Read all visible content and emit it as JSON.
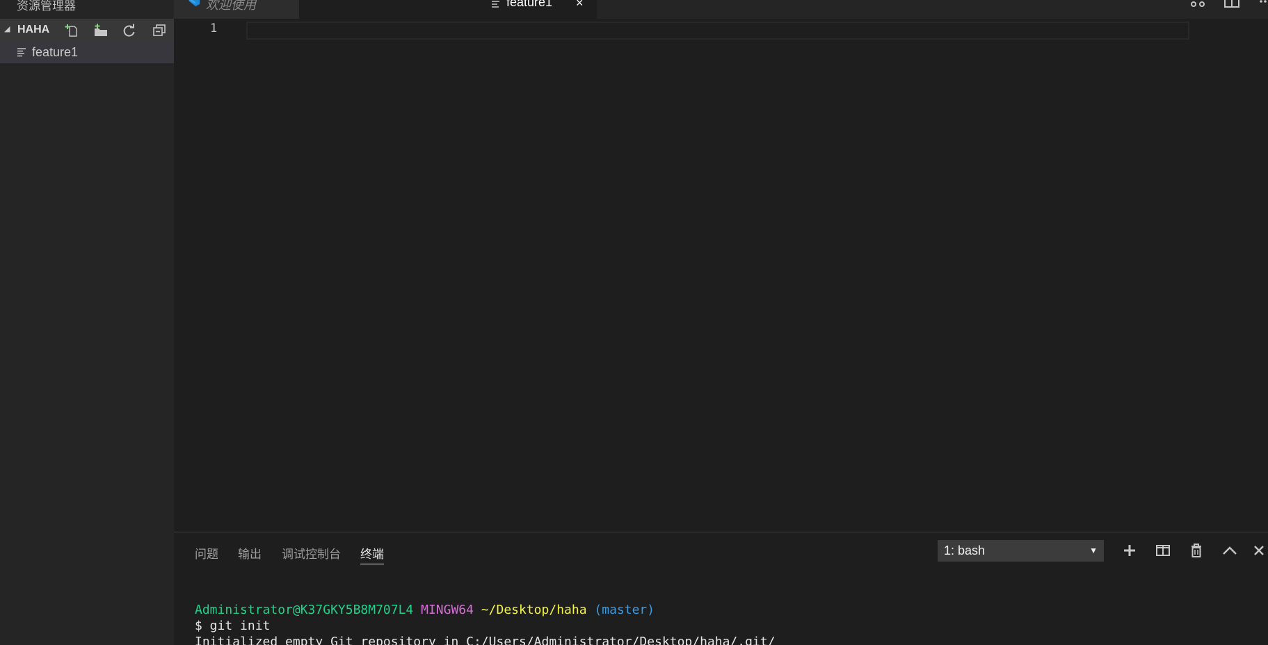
{
  "sidebar": {
    "title": "资源管理器",
    "folder": {
      "name": "HAHA",
      "actions": {
        "new_file": "new-file-icon",
        "new_folder": "new-folder-icon",
        "refresh": "refresh-icon",
        "collapse": "collapse-all-icon"
      }
    },
    "files": [
      {
        "label": "feature1",
        "icon": "file-text-icon"
      }
    ]
  },
  "tabs": [
    {
      "label": "欢迎使用",
      "icon": "vscode-logo-icon",
      "active": false
    },
    {
      "label": "feature1",
      "icon": "file-text-icon",
      "active": true,
      "close": "×"
    }
  ],
  "editor": {
    "line_numbers": [
      "1"
    ],
    "content": ""
  },
  "panel": {
    "tabs": [
      {
        "label": "问题"
      },
      {
        "label": "输出"
      },
      {
        "label": "调试控制台"
      },
      {
        "label": "终端",
        "active": true
      }
    ],
    "terminal_select": {
      "value": "1: bash"
    },
    "actions": [
      "add-icon",
      "split-terminal-icon",
      "trash-icon",
      "maximize-panel-icon",
      "close-panel-icon"
    ]
  },
  "terminal": {
    "user": "Administrator@K37GKY5B8M707L4",
    "host": "MINGW64",
    "path": "~/Desktop/haha",
    "branch": "(master)",
    "command": "$ git init",
    "output": "Initialized empty Git repository in C:/Users/Administrator/Desktop/haha/.git/"
  },
  "colors": {
    "user": "#23d18b",
    "host": "#d670d6",
    "path": "#f5f543",
    "branch": "#3b9ae1"
  }
}
